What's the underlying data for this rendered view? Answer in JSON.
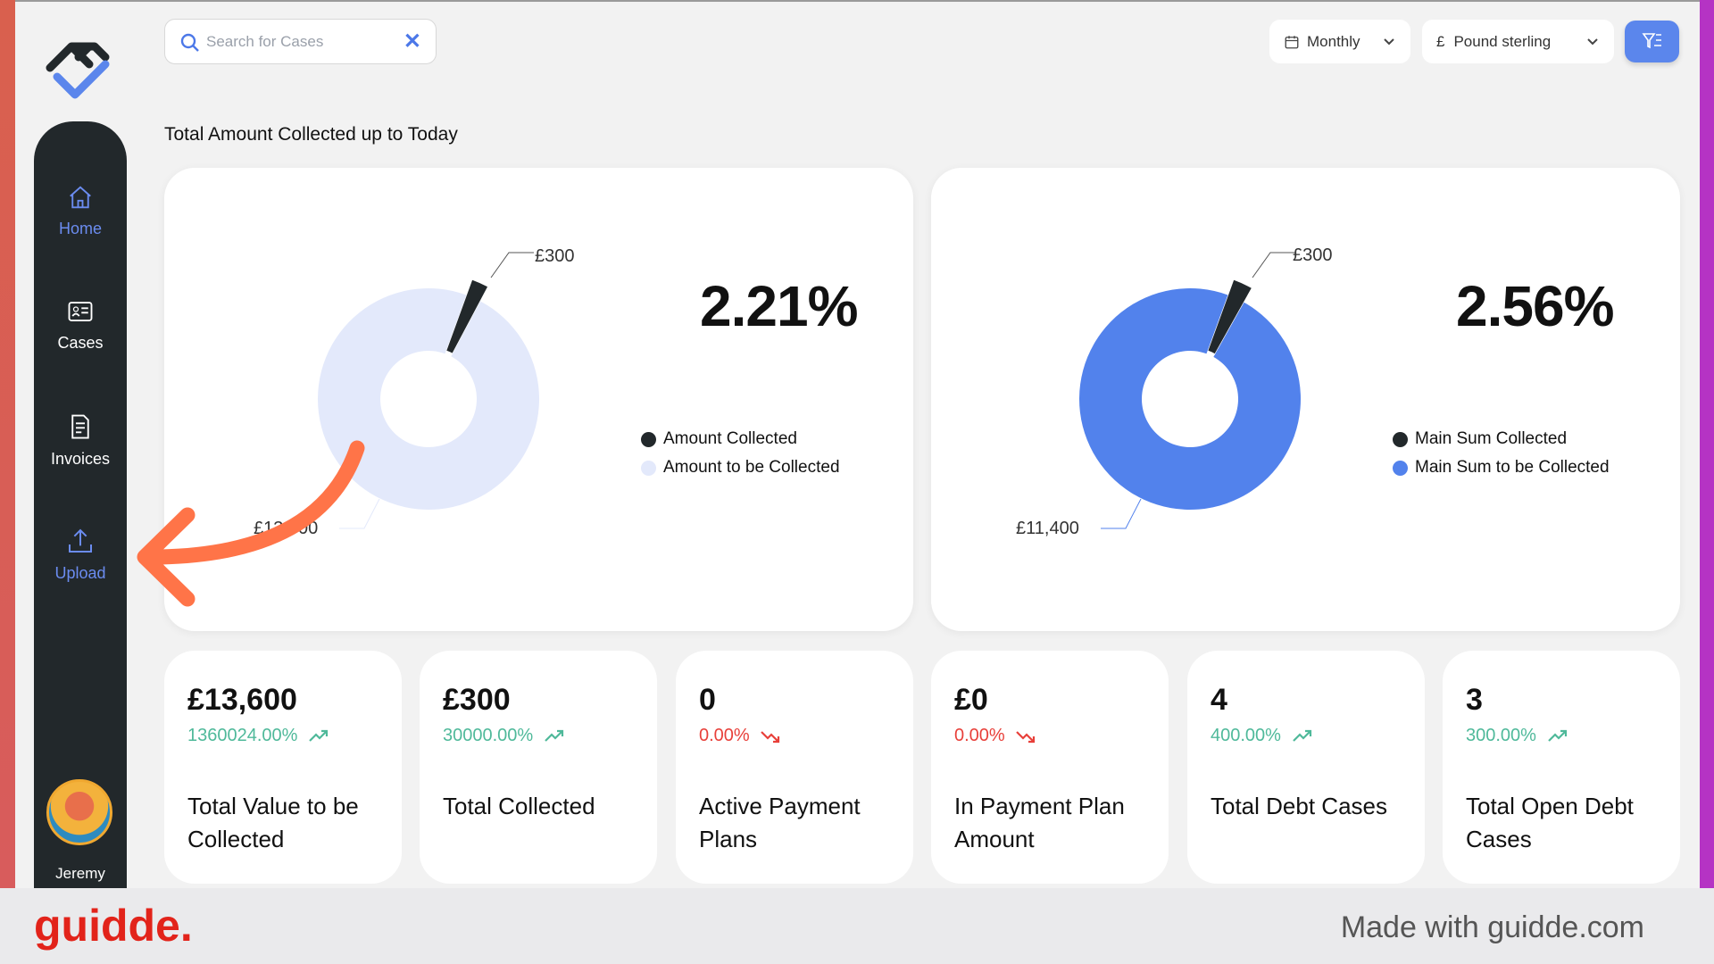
{
  "search": {
    "placeholder": "Search for Cases"
  },
  "filters": {
    "period": "Monthly",
    "currency_symbol": "£",
    "currency": "Pound sterling"
  },
  "sidebar": {
    "items": [
      {
        "label": "Home",
        "icon": "home-icon",
        "active": true
      },
      {
        "label": "Cases",
        "icon": "id-card-icon"
      },
      {
        "label": "Invoices",
        "icon": "document-icon"
      },
      {
        "label": "Upload",
        "icon": "upload-icon",
        "highlighted": true
      }
    ],
    "user": "Jeremy"
  },
  "section_title": "Total Amount Collected up to Today",
  "charts": [
    {
      "percent": "2.21%",
      "slice_labels": [
        "£300",
        "£13,300"
      ],
      "legend": [
        "Amount Collected",
        "Amount to be Collected"
      ],
      "colors": [
        "#22282b",
        "#e3e9fb"
      ]
    },
    {
      "percent": "2.56%",
      "slice_labels": [
        "£300",
        "£11,400"
      ],
      "legend": [
        "Main Sum Collected",
        "Main Sum to be Collected"
      ],
      "colors": [
        "#22282b",
        "#5282ec"
      ]
    }
  ],
  "chart_data": [
    {
      "type": "pie",
      "categories": [
        "Amount Collected",
        "Amount to be Collected"
      ],
      "values": [
        300,
        13300
      ]
    },
    {
      "type": "pie",
      "categories": [
        "Main Sum Collected",
        "Main Sum to be Collected"
      ],
      "values": [
        300,
        11400
      ]
    }
  ],
  "stats": [
    {
      "value": "£13,600",
      "change": "1360024.00%",
      "trend": "up",
      "label": "Total Value to be Collected"
    },
    {
      "value": "£300",
      "change": "30000.00%",
      "trend": "up",
      "label": "Total Collected"
    },
    {
      "value": "0",
      "change": "0.00%",
      "trend": "down",
      "label": "Active Payment Plans"
    },
    {
      "value": "£0",
      "change": "0.00%",
      "trend": "down",
      "label": "In Payment Plan Amount"
    },
    {
      "value": "4",
      "change": "400.00%",
      "trend": "up",
      "label": "Total Debt Cases"
    },
    {
      "value": "3",
      "change": "300.00%",
      "trend": "up",
      "label": "Total Open Debt Cases"
    }
  ],
  "footer": {
    "brand": "guidde.",
    "made_with": "Made with guidde.com"
  }
}
